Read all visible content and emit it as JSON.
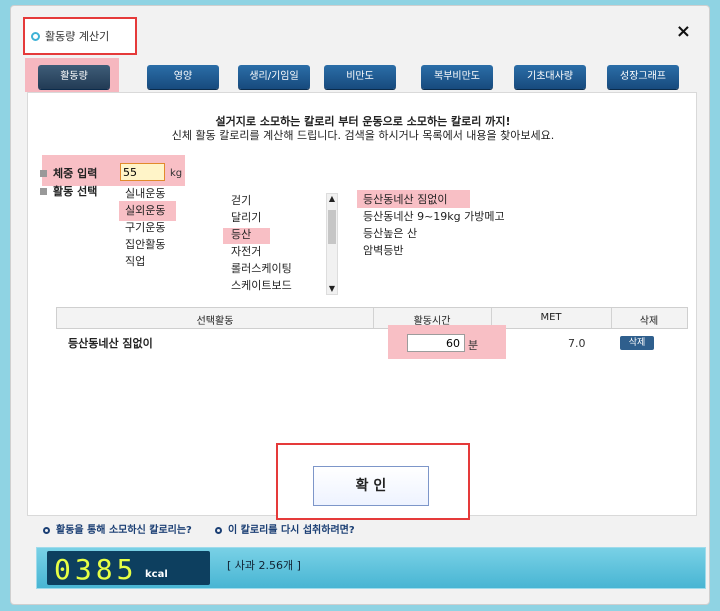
{
  "window": {
    "title": "활동량 계산기",
    "close_icon": "×"
  },
  "tabs": [
    {
      "label": "활동량",
      "active": true
    },
    {
      "label": "영양"
    },
    {
      "label": "생리/기임일"
    },
    {
      "label": "비만도"
    },
    {
      "label": "복부비만도"
    },
    {
      "label": "기초대사량"
    },
    {
      "label": "성장그래프"
    }
  ],
  "intro": {
    "line1": "설거지로 소모하는 칼로리 부터 운동으로 소모하는 칼로리 까지!",
    "line2": "신체 활동 칼로리를 계산해 드립니다. 검색을 하시거나 목록에서 내용을 찾아보세요."
  },
  "weight": {
    "label": "체중 입력",
    "value": "55",
    "unit": "kg"
  },
  "activity_select": {
    "label": "활동 선택",
    "categories": [
      "실내운동",
      "실외운동",
      "구기운동",
      "집안활동",
      "직업"
    ],
    "sub_items": [
      "걷기",
      "달리기",
      "등산",
      "자전거",
      "롤러스케이팅",
      "스케이트보드"
    ],
    "details": [
      "등산동네산 짐없이",
      "등산동네산 9~19kg 가방메고",
      "등산높은 산",
      "암벽등반"
    ]
  },
  "table": {
    "headers": [
      "선택활동",
      "활동시간",
      "MET",
      "삭제"
    ],
    "row": {
      "activity": "등산동네산 짐없이",
      "time_value": "60",
      "time_unit": "분",
      "met": "7.0",
      "delete_label": "삭제"
    }
  },
  "confirm_label": "확 인",
  "links": {
    "consumed": "활동을 통해 소모하신 칼로리는?",
    "reintake": "이 칼로리를 다시 섭취하려면?"
  },
  "result": {
    "kcal_value": "0385",
    "kcal_unit": "kcal",
    "equivalent": "[ 사과  2.56개 ]"
  },
  "colors": {
    "highlight": "#f8bfc5",
    "annotation_border": "#e53a3a",
    "tab_blue": "#174a7d",
    "display_digits": "#e7ff45"
  }
}
